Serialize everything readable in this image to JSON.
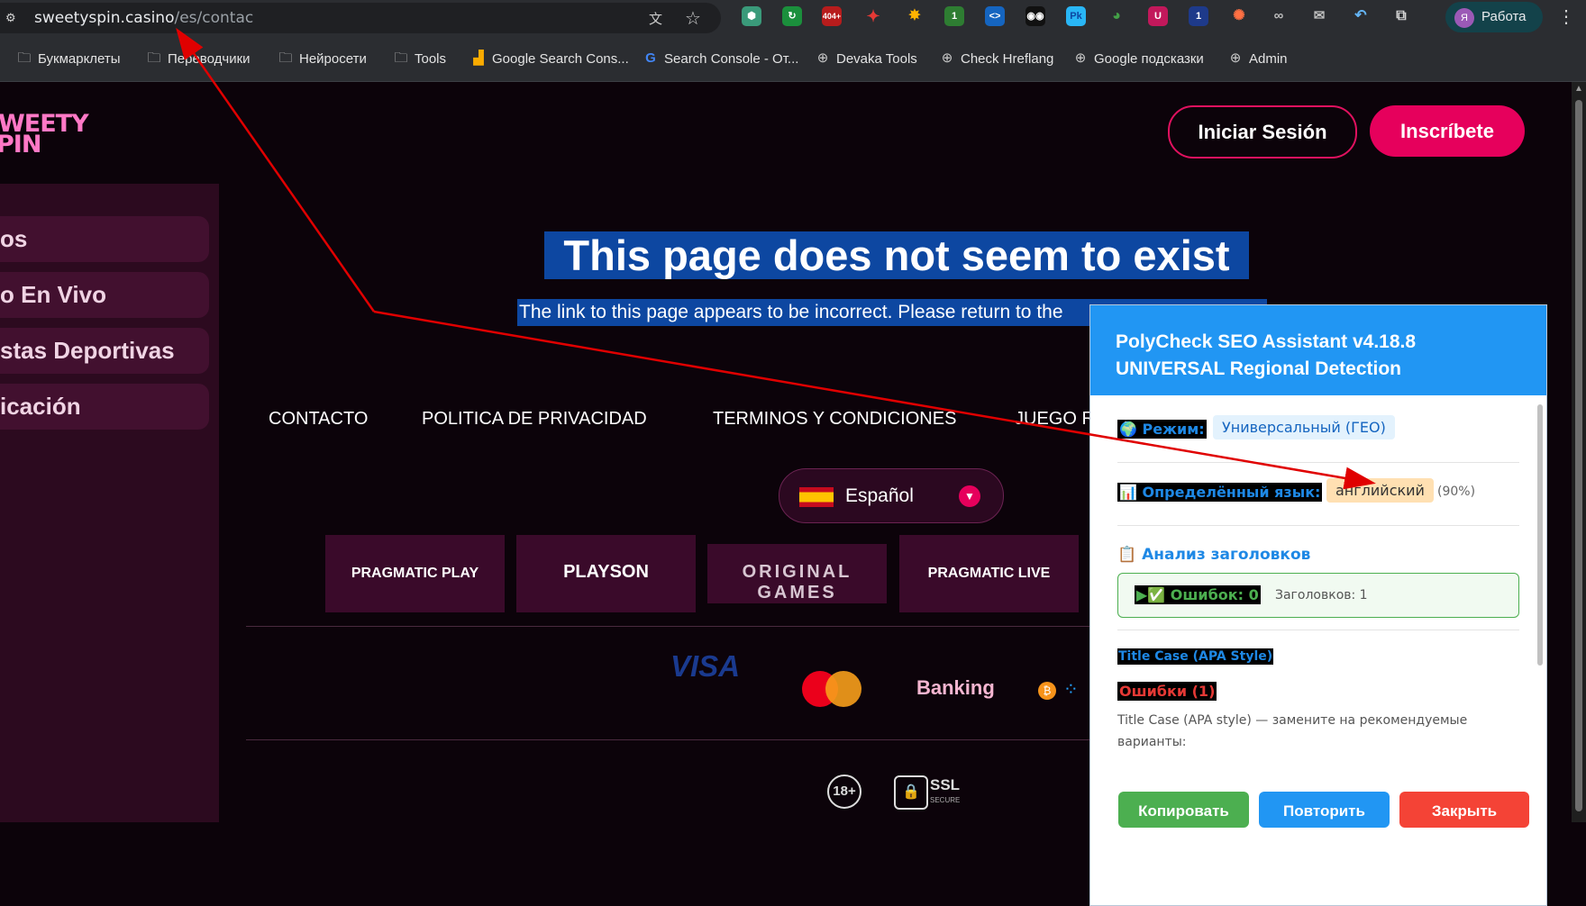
{
  "browser": {
    "url_host": "sweetyspin.casino",
    "url_path": "/es/contac",
    "profile_initial": "Я",
    "profile_label": "Работа",
    "ext_badge_404": "404+",
    "ext_badge_1a": "1",
    "ext_badge_1b": "1"
  },
  "bookmarks": [
    {
      "label": "Букмарклеты",
      "icon": "folder-icon"
    },
    {
      "label": "Переводчики",
      "icon": "folder-icon"
    },
    {
      "label": "Нейросети",
      "icon": "folder-icon"
    },
    {
      "label": "Tools",
      "icon": "folder-icon"
    },
    {
      "label": "Google Search Cons...",
      "icon": "search-console-icon"
    },
    {
      "label": "Search Console - От...",
      "icon": "google-icon"
    },
    {
      "label": "Devaka Tools",
      "icon": "globe-icon"
    },
    {
      "label": "Check Hreflang",
      "icon": "globe-icon"
    },
    {
      "label": "Google подсказки",
      "icon": "globe-icon"
    },
    {
      "label": "Admin",
      "icon": "globe-icon"
    }
  ],
  "site": {
    "logo_line1": "WEETY",
    "logo_line2": "PIN",
    "login": "Iniciar Sesión",
    "signup": "Inscríbete",
    "sidebar": [
      "os",
      "o En Vivo",
      "stas Deportivas",
      "icación"
    ],
    "title": "This page does not seem to exist",
    "subtitle": "The link to this page appears to be incorrect. Please return to the",
    "footer_links": [
      "CONTACTO",
      "POLITICA DE PRIVACIDAD",
      "TERMINOS Y CONDICIONES",
      "JUEGO R"
    ],
    "language": "Español",
    "providers": [
      "PRAGMATIC PLAY",
      "PLAYSON",
      "ORIGINAL GAMES",
      "PRAGMATIC LIVE"
    ],
    "payments": [
      "VISA",
      "Banking"
    ],
    "age": "18+",
    "ssl": "SSL",
    "ssl_sub": "SECURE"
  },
  "panel": {
    "title_line1": "PolyCheck SEO Assistant v4.18.8",
    "title_line2": "UNIVERSAL Regional Detection",
    "mode_label": "🌍 Режим:",
    "mode_value": "Универсальный (ГЕО)",
    "lang_label": "📊 Определённый язык:",
    "lang_value": "английский",
    "lang_pct": "(90%)",
    "headings_title": "📋 Анализ заголовков",
    "errors_label": "▶✅ Ошибок: 0",
    "headings_count": "Заголовков: 1",
    "title_case": "Title Case (APA Style)",
    "errors_red": "Ошибки (1)",
    "desc": "Title Case (APA style) — замените на рекомендуемые варианты:",
    "btn_copy": "Копировать",
    "btn_retry": "Повторить",
    "btn_close": "Закрыть"
  },
  "colors": {
    "accent_pink": "#e6005c",
    "panel_blue": "#2196f3",
    "highlight_blue": "#0d47a1",
    "btn_green": "#4caf50",
    "btn_red": "#f44336"
  }
}
